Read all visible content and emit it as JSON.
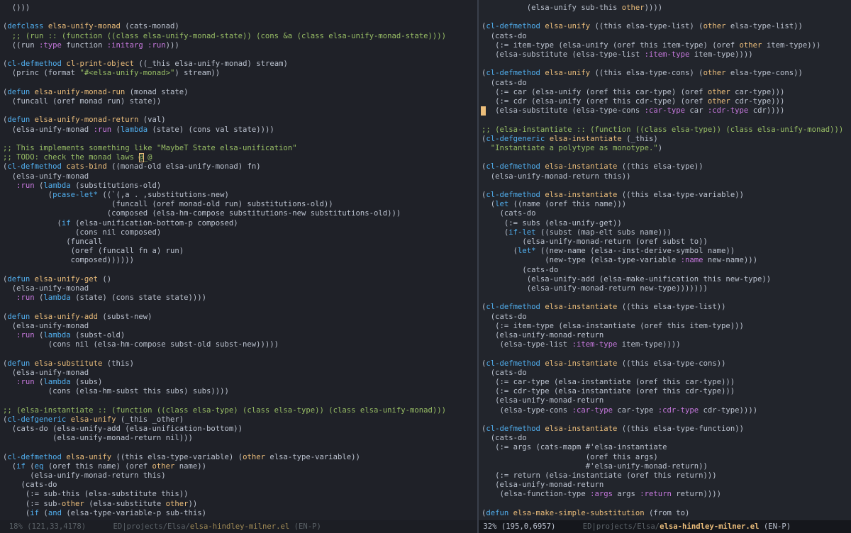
{
  "colors": {
    "background": "#1f2128",
    "text": "#bbc2cf",
    "comment": "#98be65",
    "keyword": "#51afef",
    "function": "#c678dd",
    "string": "#98be65",
    "constant": "#a9a1e1",
    "type": "#ecbe7b",
    "cursor": "#ecbe7b"
  },
  "left_pane": {
    "lines": [
      "  ()))",
      "",
      "(defclass elsa-unify-monad (cats-monad)",
      "  ;; (run :: (function ((class elsa-unify-monad-state)) (cons &a (class elsa-unify-monad-state))))",
      "  ((run :type function :initarg :run)))",
      "",
      "(cl-defmethod cl-print-object ((_this elsa-unify-monad) stream)",
      "  (princ (format \"#<elsa-unify-monad>\") stream))",
      "",
      "(defun elsa-unify-monad-run (monad state)",
      "  (funcall (oref monad run) state))",
      "",
      "(defun elsa-unify-monad-return (val)",
      "  (elsa-unify-monad :run (lambda (state) (cons val state))))",
      "",
      ";; This implements something like \"MaybeT State elsa-unification\"",
      ";; TODO: check the monad laws @_@",
      "(cl-defmethod cats-bind ((monad-old elsa-unify-monad) fn)",
      "  (elsa-unify-monad",
      "   :run (lambda (substitutions-old)",
      "          (pcase-let* ((`(,a . ,substitutions-new)",
      "                        (funcall (oref monad-old run) substitutions-old))",
      "                       (composed (elsa-hm-compose substitutions-new substitutions-old)))",
      "            (if (elsa-unification-bottom-p composed)",
      "                (cons nil composed)",
      "              (funcall",
      "               (oref (funcall fn a) run)",
      "               composed))))))",
      "",
      "(defun elsa-unify-get ()",
      "  (elsa-unify-monad",
      "   :run (lambda (state) (cons state state))))",
      "",
      "(defun elsa-unify-add (subst-new)",
      "  (elsa-unify-monad",
      "   :run (lambda (subst-old)",
      "          (cons nil (elsa-hm-compose subst-old subst-new)))))",
      "",
      "(defun elsa-substitute (this)",
      "  (elsa-unify-monad",
      "   :run (lambda (subs)",
      "          (cons (elsa-hm-subst this subs) subs))))",
      "",
      ";; (elsa-instantiate :: (function ((class elsa-type) (class elsa-type)) (class elsa-unify-monad)))",
      "(cl-defgeneric elsa-unify (_this _other)",
      "  (cats-do (elsa-unify-add (elsa-unification-bottom))",
      "           (elsa-unify-monad-return nil)))",
      "",
      "(cl-defmethod elsa-unify ((this elsa-type-variable) (other elsa-type-variable))",
      "  (if (eq (oref this name) (oref other name))",
      "      (elsa-unify-monad-return this)",
      "    (cats-do",
      "     (:= sub-this (elsa-substitute this))",
      "     (:= sub-other (elsa-substitute other))",
      "     (if (and (elsa-type-variable-p sub-this)"
    ],
    "modeline": {
      "position": "  18% (121,33,4178)",
      "mode": "ED",
      "path": "projects/Elsa/",
      "file": "elsa-hindley-milner.el",
      "input": "(EN-P)"
    }
  },
  "right_pane": {
    "lines": [
      "          (elsa-unify sub-this other))))",
      "",
      "(cl-defmethod elsa-unify ((this elsa-type-list) (other elsa-type-list))",
      "  (cats-do",
      "   (:= item-type (elsa-unify (oref this item-type) (oref other item-type)))",
      "   (elsa-substitute (elsa-type-list :item-type item-type))))",
      "",
      "(cl-defmethod elsa-unify ((this elsa-type-cons) (other elsa-type-cons))",
      "  (cats-do",
      "   (:= car (elsa-unify (oref this car-type) (oref other car-type)))",
      "   (:= cdr (elsa-unify (oref this cdr-type) (oref other cdr-type)))",
      "   (elsa-substitute (elsa-type-cons :car-type car :cdr-type cdr))))",
      "",
      ";; (elsa-instantiate :: (function ((class elsa-type)) (class elsa-unify-monad)))",
      "(cl-defgeneric elsa-instantiate (_this)",
      "  \"Instantiate a polytype as monotype.\")",
      "",
      "(cl-defmethod elsa-instantiate ((this elsa-type))",
      "  (elsa-unify-monad-return this))",
      "",
      "(cl-defmethod elsa-instantiate ((this elsa-type-variable))",
      "  (let ((name (oref this name)))",
      "    (cats-do",
      "     (:= subs (elsa-unify-get))",
      "     (if-let ((subst (map-elt subs name)))",
      "         (elsa-unify-monad-return (oref subst to))",
      "       (let* ((new-name (elsa--inst-derive-symbol name))",
      "              (new-type (elsa-type-variable :name new-name)))",
      "         (cats-do",
      "          (elsa-unify-add (elsa-make-unification this new-type))",
      "          (elsa-unify-monad-return new-type)))))))",
      "",
      "(cl-defmethod elsa-instantiate ((this elsa-type-list))",
      "  (cats-do",
      "   (:= item-type (elsa-instantiate (oref this item-type)))",
      "   (elsa-unify-monad-return",
      "    (elsa-type-list :item-type item-type))))",
      "",
      "(cl-defmethod elsa-instantiate ((this elsa-type-cons))",
      "  (cats-do",
      "   (:= car-type (elsa-instantiate (oref this car-type)))",
      "   (:= cdr-type (elsa-instantiate (oref this cdr-type)))",
      "   (elsa-unify-monad-return",
      "    (elsa-type-cons :car-type car-type :cdr-type cdr-type))))",
      "",
      "(cl-defmethod elsa-instantiate ((this elsa-type-function))",
      "  (cats-do",
      "   (:= args (cats-mapm #'elsa-instantiate",
      "                       (oref this args)",
      "                       #'elsa-unify-monad-return))",
      "   (:= return (elsa-instantiate (oref this return)))",
      "   (elsa-unify-monad-return",
      "    (elsa-function-type :args args :return return))))",
      "",
      "(defun elsa-make-simple-substitution (from to)"
    ],
    "modeline": {
      "position": " 32% (195,0,6957)",
      "mode": "ED",
      "path": "projects/Elsa/",
      "file": "elsa-hindley-milner.el",
      "input": "(EN-P)"
    }
  }
}
